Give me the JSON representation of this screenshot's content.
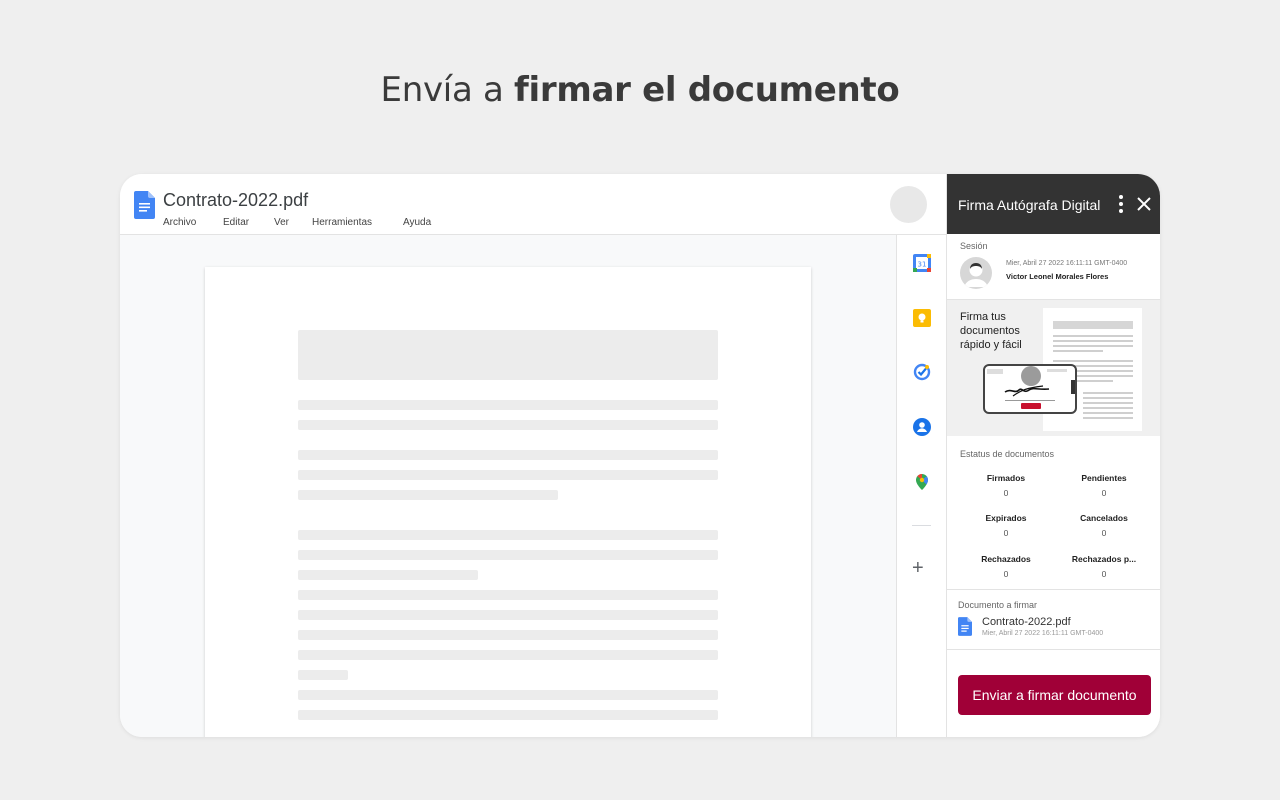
{
  "headline": {
    "normal": "Envía a ",
    "bold": "firmar el documento"
  },
  "docs": {
    "title": "Contrato-2022.pdf",
    "menu": [
      "Archivo",
      "Editar",
      "Ver",
      "Herramientas",
      "Ayuda"
    ]
  },
  "rail": {
    "icons": [
      "calendar-icon",
      "keep-icon",
      "tasks-icon",
      "contacts-icon",
      "maps-icon",
      "add-icon"
    ]
  },
  "panel": {
    "title": "Firma Autógrafa Digital",
    "session_label": "Sesión",
    "session_date": "Mier, Abril 27 2022 16:11:11 GMT-0400",
    "session_name": "Victor Leonel Morales Flores",
    "promo_text": "Firma tus documentos rápido y fácil",
    "status_label": "Estatus de documentos",
    "stats": [
      {
        "label": "Firmados",
        "value": "0"
      },
      {
        "label": "Pendientes",
        "value": "0"
      },
      {
        "label": "Expirados",
        "value": "0"
      },
      {
        "label": "Cancelados",
        "value": "0"
      },
      {
        "label": "Rechazados",
        "value": "0"
      },
      {
        "label": "Rechazados p...",
        "value": "0"
      }
    ],
    "doc_label": "Documento a firmar",
    "doc_name": "Contrato-2022.pdf",
    "doc_date": "Mier, Abril 27 2022 16:11:11 GMT-0400",
    "send_button": "Enviar a firmar documento"
  },
  "colors": {
    "accent": "#a00037",
    "panel_header": "#333333",
    "docs_blue": "#4285f4"
  }
}
